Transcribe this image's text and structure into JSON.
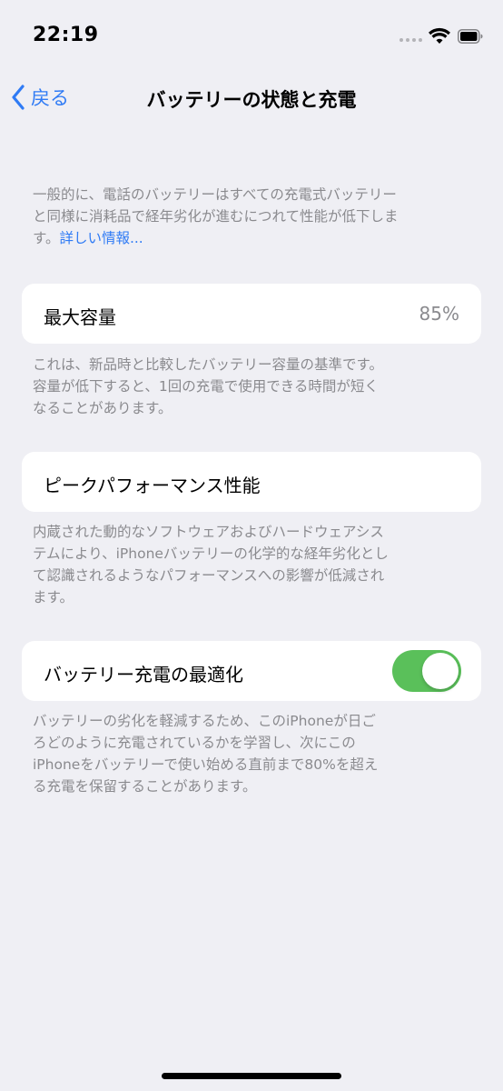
{
  "status_bar": {
    "time": "22:19"
  },
  "nav": {
    "back_label": "戻る",
    "title": "バッテリーの状態と充電"
  },
  "intro": {
    "lines": [
      "一般的に、電話のバッテリーはすべての充電式バッテリー",
      "と同様に消耗品で経年劣化が進むにつれて性能が低下しま",
      "す。"
    ],
    "link": "詳しい情報..."
  },
  "max_capacity": {
    "label": "最大容量",
    "value": "85%",
    "description": [
      "これは、新品時と比較したバッテリー容量の基準です。",
      "容量が低下すると、1回の充電で使用できる時間が短く",
      "なることがあります。"
    ]
  },
  "peak_performance": {
    "label": "ピークパフォーマンス性能",
    "description": [
      "内蔵された動的なソフトウェアおよびハードウェアシス",
      "テムにより、iPhoneバッテリーの化学的な経年劣化とし",
      "て認識されるようなパフォーマンスへの影響が低減され",
      "ます。"
    ]
  },
  "optimized_charging": {
    "label": "バッテリー充電の最適化",
    "enabled": true,
    "description": [
      "バッテリーの劣化を軽減するため、このiPhoneが日ご",
      "ろどのように充電されているかを学習し、次にこの",
      "iPhoneをバッテリーで使い始める直前まで80%を超え",
      "る充電を保留することがあります。"
    ]
  },
  "colors": {
    "accent": "#2f7bf5",
    "toggle_on": "#5ac05a",
    "background": "#efeff4",
    "secondary_text": "#8a8a8e"
  }
}
